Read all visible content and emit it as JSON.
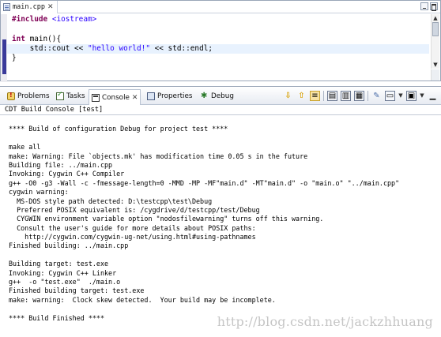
{
  "editor": {
    "tab_label": "main.cpp",
    "code_lines": [
      {
        "parts": [
          {
            "t": "#include ",
            "c": "kw"
          },
          {
            "t": "<iostream>",
            "c": "str"
          }
        ]
      },
      {
        "parts": []
      },
      {
        "parts": [
          {
            "t": "int",
            "c": "kw"
          },
          {
            "t": " main(){",
            "c": ""
          }
        ]
      },
      {
        "parts": [
          {
            "t": "    std::cout << ",
            "c": ""
          },
          {
            "t": "\"hello world!\"",
            "c": "str"
          },
          {
            "t": " << std::endl;",
            "c": ""
          }
        ],
        "highlight": true
      },
      {
        "parts": [
          {
            "t": "}",
            "c": ""
          }
        ]
      }
    ]
  },
  "views": {
    "tabs": [
      {
        "label": "Problems",
        "icon": "problems-icon"
      },
      {
        "label": "Tasks",
        "icon": "tasks-icon"
      },
      {
        "label": "Console",
        "icon": "console-icon",
        "active": true
      },
      {
        "label": "Properties",
        "icon": "properties-icon"
      },
      {
        "label": "Debug",
        "icon": "debug-icon"
      }
    ],
    "close_glyph": "✕"
  },
  "console": {
    "title": "CDT Build Console [test]",
    "lines": [
      "",
      "**** Build of configuration Debug for project test ****",
      "",
      "make all",
      "make: Warning: File `objects.mk' has modification time 0.05 s in the future",
      "Building file: ../main.cpp",
      "Invoking: Cygwin C++ Compiler",
      "g++ -O0 -g3 -Wall -c -fmessage-length=0 -MMD -MP -MF\"main.d\" -MT\"main.d\" -o \"main.o\" \"../main.cpp\"",
      "cygwin warning:",
      "  MS-DOS style path detected: D:\\testcpp\\test\\Debug",
      "  Preferred POSIX equivalent is: /cygdrive/d/testcpp/test/Debug",
      "  CYGWIN environment variable option \"nodosfilewarning\" turns off this warning.",
      "  Consult the user's guide for more details about POSIX paths:",
      "    http://cygwin.com/cygwin-ug-net/using.html#using-pathnames",
      "Finished building: ../main.cpp",
      "",
      "Building target: test.exe",
      "Invoking: Cygwin C++ Linker",
      "g++  -o \"test.exe\"  ./main.o",
      "Finished building target: test.exe",
      "make: warning:  Clock skew detected.  Your build may be incomplete.",
      "",
      "**** Build Finished ****"
    ],
    "watermark": "http://blog.csdn.net/jackzhhuang"
  }
}
